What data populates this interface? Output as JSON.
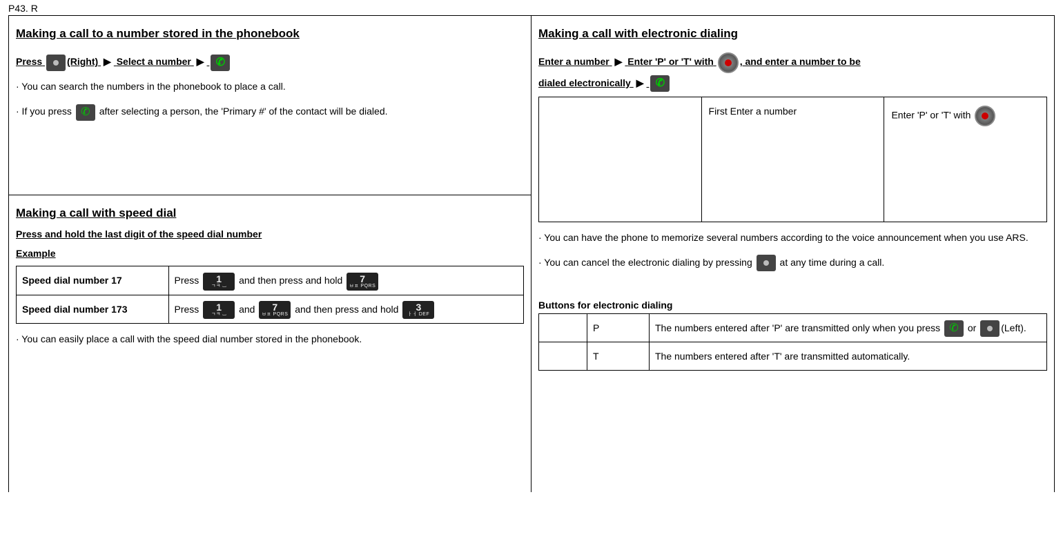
{
  "page_label": "P43. R",
  "left": {
    "section1": {
      "title": "Making a call to a number stored in the phonebook",
      "steps_prefix": "Press",
      "steps_right": "(Right)",
      "steps_select": "Select a number",
      "para1": "· You can search the numbers in the phonebook to place a call.",
      "para2_pre": "· If you press",
      "para2_post": " after selecting a person, the 'Primary #' of the contact will be dialed."
    },
    "section2": {
      "title": "Making a call with speed dial",
      "sub1": "Press and hold the last digit of the speed dial number",
      "sub2": "Example",
      "rows": [
        {
          "label": "Speed dial number 17",
          "t1": "Press ",
          "t2": " and then press and hold "
        },
        {
          "label": "Speed dial number 173",
          "t1": "Press ",
          "t2": " and ",
          "t3": " and then press and hold "
        }
      ],
      "para": "· You can easily place a call with the speed dial number stored in the phonebook."
    }
  },
  "right": {
    "title": "Making a call with electronic dialing",
    "steps_enter": "Enter a number",
    "steps_pt_pre": "Enter 'P' or 'T' with",
    "steps_pt_post": ", and enter a number to be",
    "steps_line2": "dialed electronically",
    "grid": {
      "c2": "First Enter a number",
      "c3": "Enter 'P' or 'T' with"
    },
    "para1": "· You can have the phone to memorize several numbers according to the voice announcement when you use ARS.",
    "para2_pre": "· You can cancel the electronic dialing by pressing",
    "para2_post": " at any time during a call.",
    "buttons_heading": "Buttons for electronic dialing",
    "buttons": [
      {
        "code": "P",
        "desc_pre": "The numbers entered after 'P' are transmitted only when you press ",
        "desc_mid": " or ",
        "desc_post": "(Left)."
      },
      {
        "code": "T",
        "desc": "The numbers entered after 'T' are transmitted automatically."
      }
    ]
  }
}
